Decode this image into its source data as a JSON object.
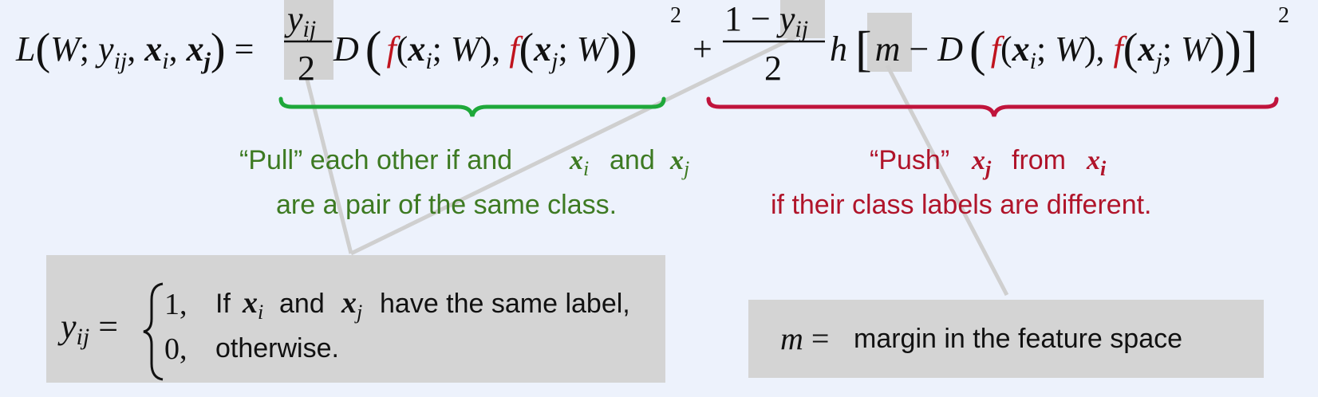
{
  "formula": {
    "lhs": "L(W; y_ij, x_i, x_j) =",
    "term1_fraction": "y_ij / 2",
    "term2_fraction": "1 − y_ij / 2",
    "exponent": "2"
  },
  "annotations": {
    "pull_line1": "“Pull” each other if and",
    "pull_and": "and",
    "pull_line2": "are a pair of the same class.",
    "push_prefix": "“Push”",
    "push_from": "from",
    "push_line2": "if their class labels are different."
  },
  "definition_box": {
    "yij_case1_text_a": "If",
    "yij_case1_text_b": "and",
    "yij_case1_text_c": "have the same label,",
    "yij_case1_value": "1,",
    "yij_case0_value": "0,",
    "yij_case0_text": "otherwise."
  },
  "margin_box": {
    "text": "margin in the feature space"
  },
  "colors": {
    "background": "#edf2fc",
    "green_brace": "#1ea83a",
    "red_brace": "#c0143c",
    "green_text": "#3d7a22",
    "red_text": "#b0142a",
    "function_f": "#c0141e",
    "gray_box": "#d4d4d4"
  }
}
